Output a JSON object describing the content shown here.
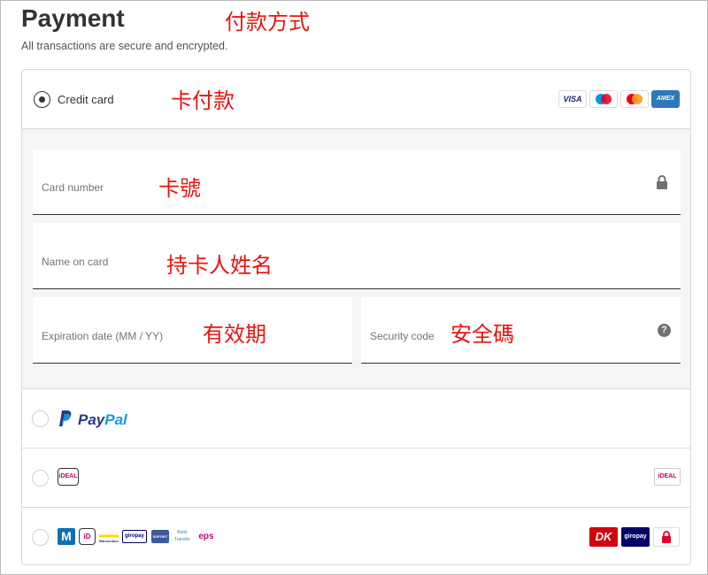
{
  "header": {
    "title": "Payment",
    "subtitle": "All transactions are secure and encrypted."
  },
  "annotations": {
    "payment_method": "付款方式",
    "card_payment": "卡付款",
    "card_number": "卡號",
    "cardholder_name": "持卡人姓名",
    "expiration": "有效期",
    "security_code": "安全碼",
    "color": "#e8140f"
  },
  "methods": {
    "credit_card": {
      "label": "Credit card",
      "selected": true,
      "logos": [
        "VISA",
        "maestro",
        "mastercard",
        "AMEX"
      ]
    },
    "paypal": {
      "label_a": "Pay",
      "label_b": "Pal"
    },
    "ideal": {
      "badge": "iDEAL"
    },
    "multi": {
      "badges": [
        "M",
        "iD",
        "Bancontact",
        "giropay",
        "SOFORT",
        "Bank Transfer",
        "eps"
      ],
      "right_badges": [
        "DK",
        "giropay"
      ]
    }
  },
  "form": {
    "card_number_placeholder": "Card number",
    "name_placeholder": "Name on card",
    "expiry_placeholder": "Expiration date (MM / YY)",
    "security_placeholder": "Security code",
    "help_glyph": "?"
  }
}
